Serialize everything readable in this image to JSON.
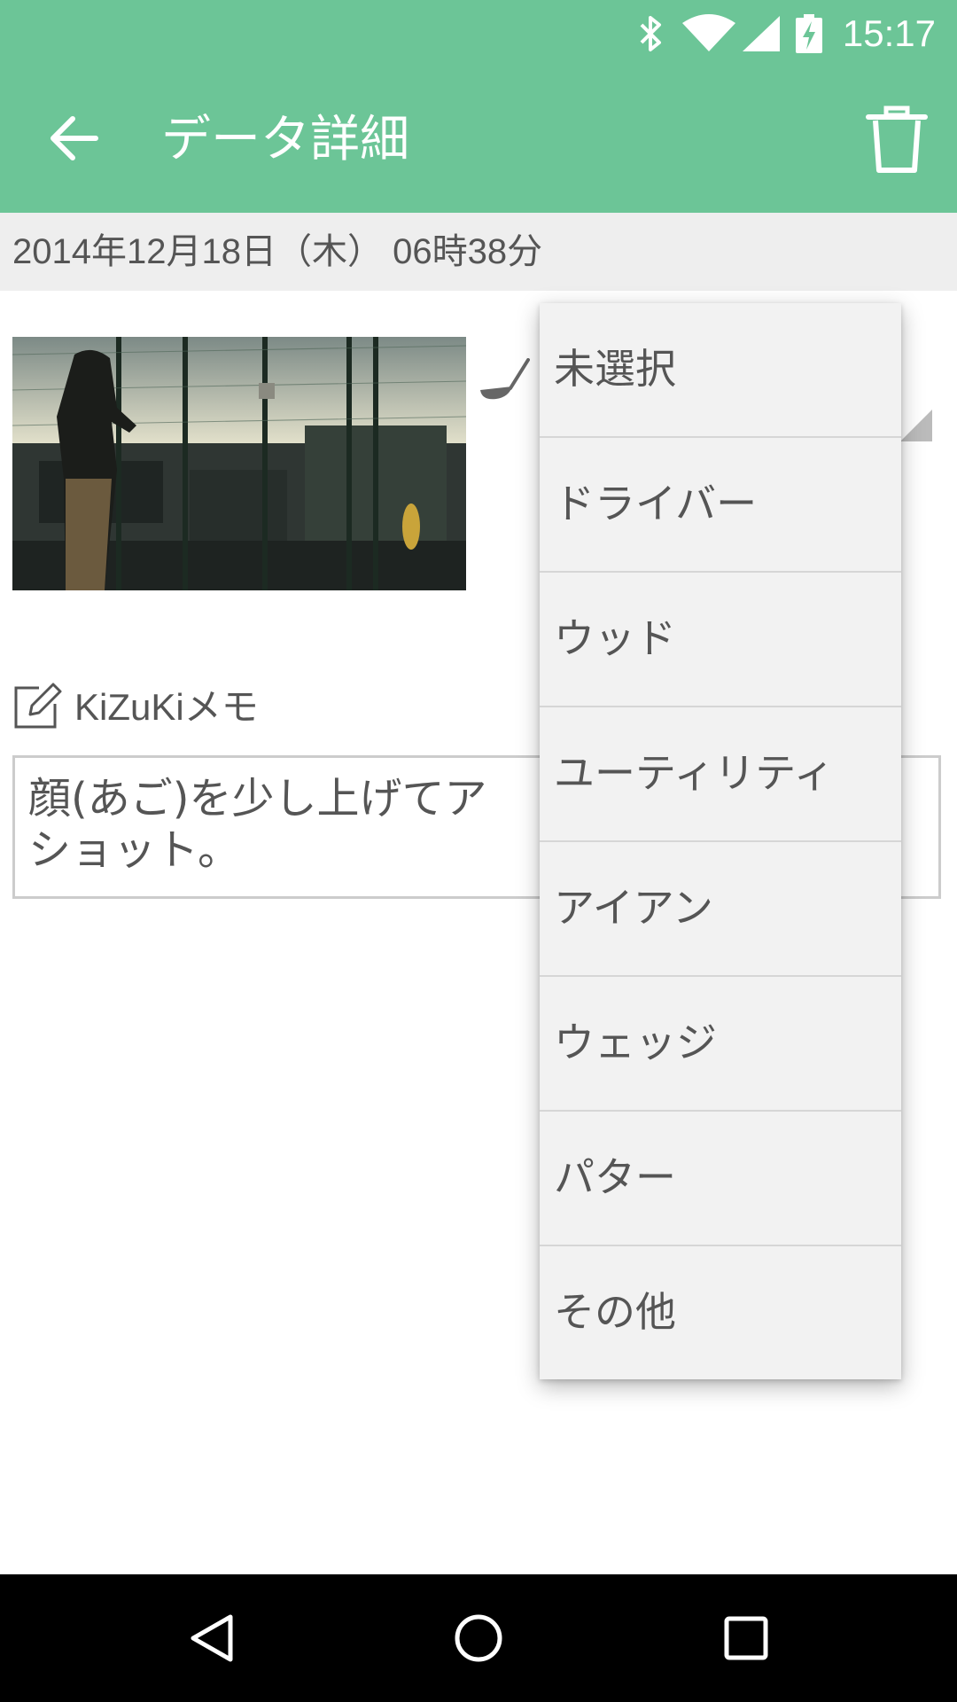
{
  "status_bar": {
    "time": "15:17",
    "icons": [
      "bluetooth-icon",
      "wifi-icon",
      "cell-signal-icon",
      "battery-charging-icon"
    ]
  },
  "app_bar": {
    "title": "データ詳細",
    "back_icon": "arrow-back-icon",
    "delete_icon": "trash-icon",
    "color": "#6cc597"
  },
  "date_text": "2014年12月18日（木） 06時38分",
  "memo": {
    "label": "KiZuKiメモ",
    "text": "顔(あご)を少し上げてアドレスすると、安定したショット。",
    "text_visible": "顔(あご)を少し上げてア                    定\nショット。"
  },
  "club_dropdown": {
    "options": [
      "未選択",
      "ドライバー",
      "ウッド",
      "ユーティリティ",
      "アイアン",
      "ウェッジ",
      "パター",
      "その他"
    ]
  },
  "nav_bar": {
    "icons": [
      "back-triangle-icon",
      "home-circle-icon",
      "recents-square-icon"
    ]
  }
}
